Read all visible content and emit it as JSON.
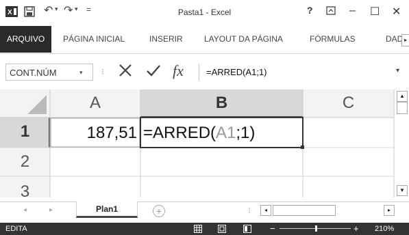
{
  "title": "Pasta1 - Excel",
  "quick_access": {
    "save_icon": "save-icon",
    "undo_icon": "undo-icon",
    "redo_icon": "redo-icon"
  },
  "window_controls": {
    "help": "?",
    "minimize": "–",
    "maximize": "☐",
    "close": "✕"
  },
  "tabs": [
    {
      "label": "ARQUIVO"
    },
    {
      "label": "PÁGINA INICIAL"
    },
    {
      "label": "INSERIR"
    },
    {
      "label": "LAYOUT DA PÁGINA"
    },
    {
      "label": "FÓRMULAS"
    },
    {
      "label": "DAD"
    }
  ],
  "name_box": {
    "value": "CONT.NÚM"
  },
  "formula": {
    "value": "=ARRED(A1;1)",
    "fx": "fx"
  },
  "columns": [
    "A",
    "B",
    "C"
  ],
  "rows": [
    "1",
    "2",
    "3"
  ],
  "cells": {
    "a1": "187,51",
    "b1_prefix": "=ARRED(",
    "b1_ref": "A1",
    "b1_suffix": ";1)"
  },
  "sheets": [
    {
      "label": "Plan1"
    }
  ],
  "status": {
    "mode": "EDITA",
    "zoom": "210%"
  },
  "colors": {
    "file_tab_bg": "#2a2a2a",
    "status_bg": "#333333",
    "ref_color": "#9a9a9a",
    "active_border": "#333333"
  }
}
